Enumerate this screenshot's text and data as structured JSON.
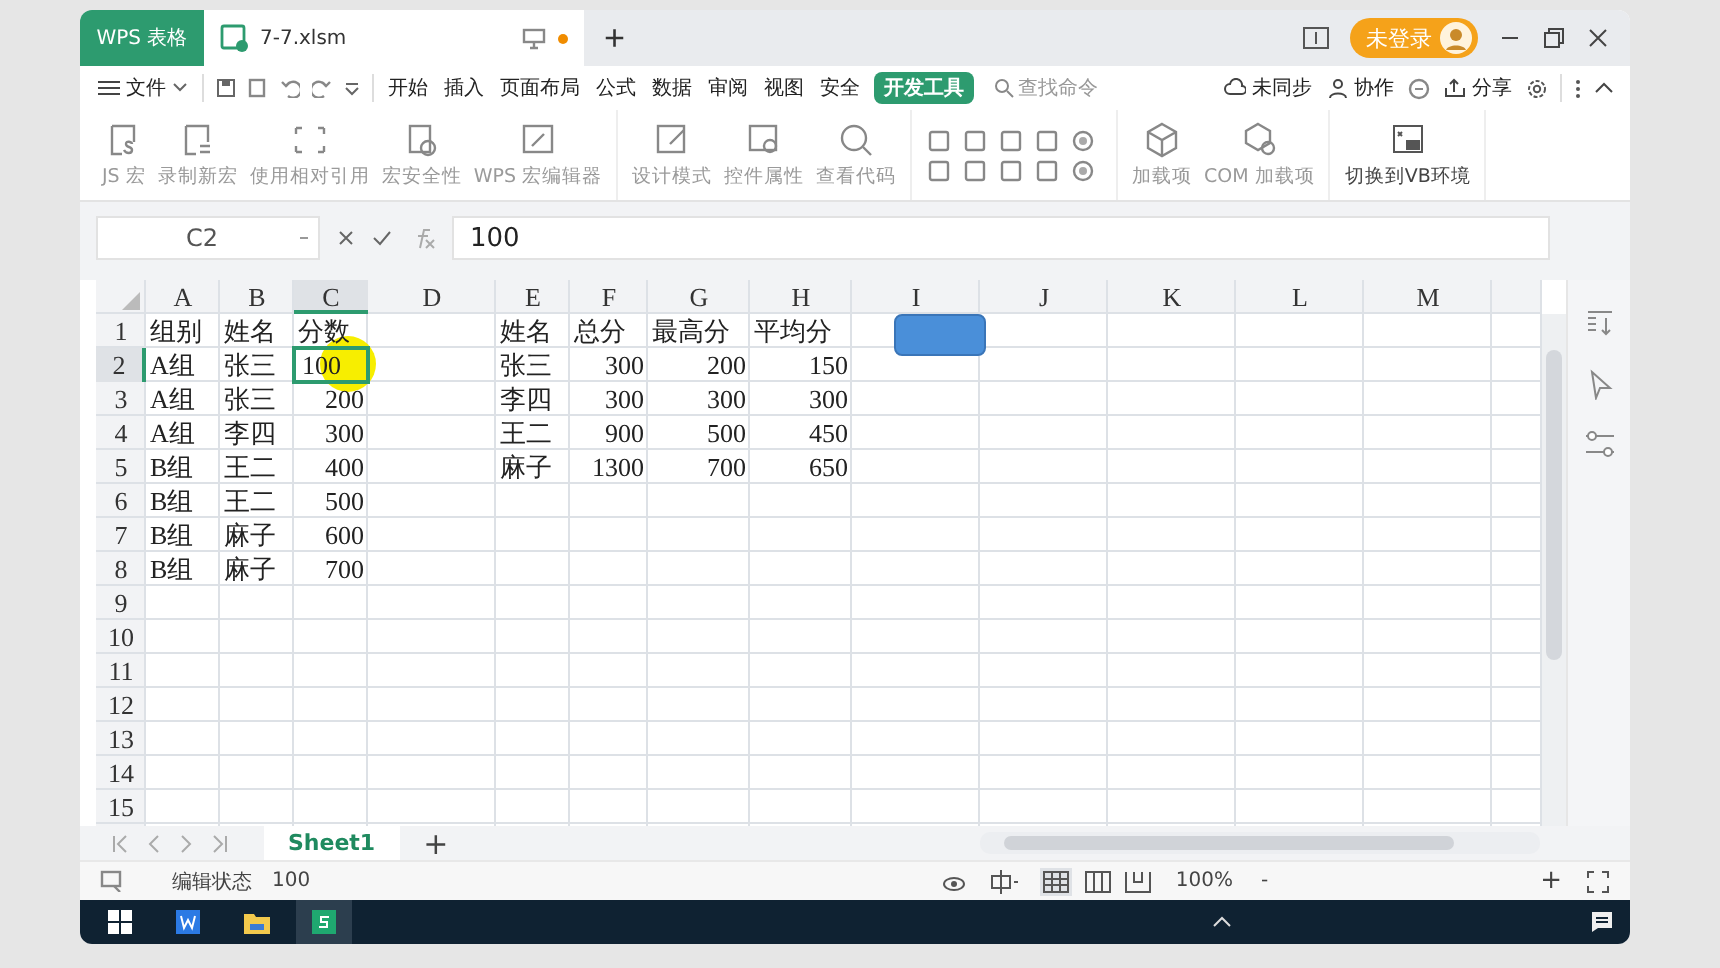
{
  "title_bar": {
    "tabs": [
      {
        "label": "WPS 表格",
        "kind": "app",
        "selected": false,
        "unsaved": false
      },
      {
        "label": "7-7.xlsm",
        "kind": "doc",
        "selected": true,
        "unsaved": true
      }
    ],
    "new_tab": "+",
    "login": "未登录"
  },
  "menu": {
    "file": "文件",
    "tabs": [
      {
        "label": "开始",
        "selected": false
      },
      {
        "label": "插入",
        "selected": false
      },
      {
        "label": "页面布局",
        "selected": false
      },
      {
        "label": "公式",
        "selected": false
      },
      {
        "label": "数据",
        "selected": false
      },
      {
        "label": "审阅",
        "selected": false
      },
      {
        "label": "视图",
        "selected": false
      },
      {
        "label": "安全",
        "selected": false
      },
      {
        "label": "开发工具",
        "selected": true
      }
    ],
    "search": {
      "placeholder": "查找命令"
    },
    "actions": [
      "未同步",
      "协作",
      "分享"
    ]
  },
  "ribbon": {
    "groups": [
      {
        "buttons": [
          {
            "label": "JS 宏",
            "disabled": true
          },
          {
            "label": "录制新宏",
            "disabled": true
          },
          {
            "label": "使用相对引用",
            "disabled": true
          },
          {
            "label": "宏安全性",
            "disabled": true
          },
          {
            "label": "WPS 宏编辑器",
            "disabled": true
          }
        ]
      },
      {
        "buttons": [
          {
            "label": "设计模式",
            "disabled": true
          },
          {
            "label": "控件属性",
            "disabled": true
          },
          {
            "label": "查看代码",
            "disabled": true
          }
        ]
      },
      {
        "buttons": [
          {
            "label": "加载项",
            "disabled": true
          },
          {
            "label": "COM 加载项",
            "disabled": true
          }
        ]
      },
      {
        "buttons": [
          {
            "label": "切换到VB环境",
            "disabled": false
          }
        ]
      }
    ]
  },
  "formula_bar": {
    "name_box": "C2",
    "value": "100"
  },
  "sheet": {
    "columns": [
      {
        "label": "A",
        "selected": false
      },
      {
        "label": "B",
        "selected": false
      },
      {
        "label": "C",
        "selected": true
      },
      {
        "label": "D",
        "selected": false
      },
      {
        "label": "E",
        "selected": false
      },
      {
        "label": "F",
        "selected": false
      },
      {
        "label": "G",
        "selected": false
      },
      {
        "label": "H",
        "selected": false
      },
      {
        "label": "I",
        "selected": false
      },
      {
        "label": "J",
        "selected": false
      },
      {
        "label": "K",
        "selected": false
      },
      {
        "label": "L",
        "selected": false
      },
      {
        "label": "M",
        "selected": false
      }
    ],
    "rows": [
      {
        "header": "1",
        "selected": false,
        "cells": [
          {
            "text": "组别",
            "kind": "text"
          },
          {
            "text": "姓名",
            "kind": "text"
          },
          {
            "text": "分数",
            "kind": "text"
          },
          null,
          {
            "text": "姓名",
            "kind": "text"
          },
          {
            "text": "总分",
            "kind": "text"
          },
          {
            "text": "最高分",
            "kind": "text"
          },
          {
            "text": "平均分",
            "kind": "text"
          }
        ]
      },
      {
        "header": "2",
        "selected": true,
        "cells": [
          {
            "text": "A组",
            "kind": "text"
          },
          {
            "text": "张三",
            "kind": "text"
          },
          {
            "text": "100",
            "kind": "editing"
          },
          null,
          {
            "text": "张三",
            "kind": "text"
          },
          {
            "text": "300",
            "kind": "number"
          },
          {
            "text": "200",
            "kind": "number"
          },
          {
            "text": "150",
            "kind": "number"
          }
        ]
      },
      {
        "header": "3",
        "selected": false,
        "cells": [
          {
            "text": "A组",
            "kind": "text"
          },
          {
            "text": "张三",
            "kind": "text"
          },
          {
            "text": "200",
            "kind": "number"
          },
          null,
          {
            "text": "李四",
            "kind": "text"
          },
          {
            "text": "300",
            "kind": "number"
          },
          {
            "text": "300",
            "kind": "number"
          },
          {
            "text": "300",
            "kind": "number"
          }
        ]
      },
      {
        "header": "4",
        "selected": false,
        "cells": [
          {
            "text": "A组",
            "kind": "text"
          },
          {
            "text": "李四",
            "kind": "text"
          },
          {
            "text": "300",
            "kind": "number"
          },
          null,
          {
            "text": "王二",
            "kind": "text"
          },
          {
            "text": "900",
            "kind": "number"
          },
          {
            "text": "500",
            "kind": "number"
          },
          {
            "text": "450",
            "kind": "number"
          }
        ]
      },
      {
        "header": "5",
        "selected": false,
        "cells": [
          {
            "text": "B组",
            "kind": "text"
          },
          {
            "text": "王二",
            "kind": "text"
          },
          {
            "text": "400",
            "kind": "number"
          },
          null,
          {
            "text": "麻子",
            "kind": "text"
          },
          {
            "text": "1300",
            "kind": "number"
          },
          {
            "text": "700",
            "kind": "number"
          },
          {
            "text": "650",
            "kind": "number"
          }
        ]
      },
      {
        "header": "6",
        "selected": false,
        "cells": [
          {
            "text": "B组",
            "kind": "text"
          },
          {
            "text": "王二",
            "kind": "text"
          },
          {
            "text": "500",
            "kind": "number"
          }
        ]
      },
      {
        "header": "7",
        "selected": false,
        "cells": [
          {
            "text": "B组",
            "kind": "text"
          },
          {
            "text": "麻子",
            "kind": "text"
          },
          {
            "text": "600",
            "kind": "number"
          }
        ]
      },
      {
        "header": "8",
        "selected": false,
        "cells": [
          {
            "text": "B组",
            "kind": "text"
          },
          {
            "text": "麻子",
            "kind": "text"
          },
          {
            "text": "700",
            "kind": "number"
          }
        ]
      },
      {
        "header": "9",
        "selected": false
      },
      {
        "header": "10",
        "selected": false
      },
      {
        "header": "11",
        "selected": false
      },
      {
        "header": "12",
        "selected": false
      },
      {
        "header": "13",
        "selected": false
      },
      {
        "header": "14",
        "selected": false
      },
      {
        "header": "15",
        "selected": false
      }
    ],
    "sheet_tabs": [
      {
        "label": "Sheet1",
        "selected": true
      }
    ],
    "add_sheet": "+"
  },
  "status_bar": {
    "mode": "编辑状态",
    "value": "100",
    "zoom": "100%",
    "zoom_out": "-",
    "zoom_in": "+"
  }
}
